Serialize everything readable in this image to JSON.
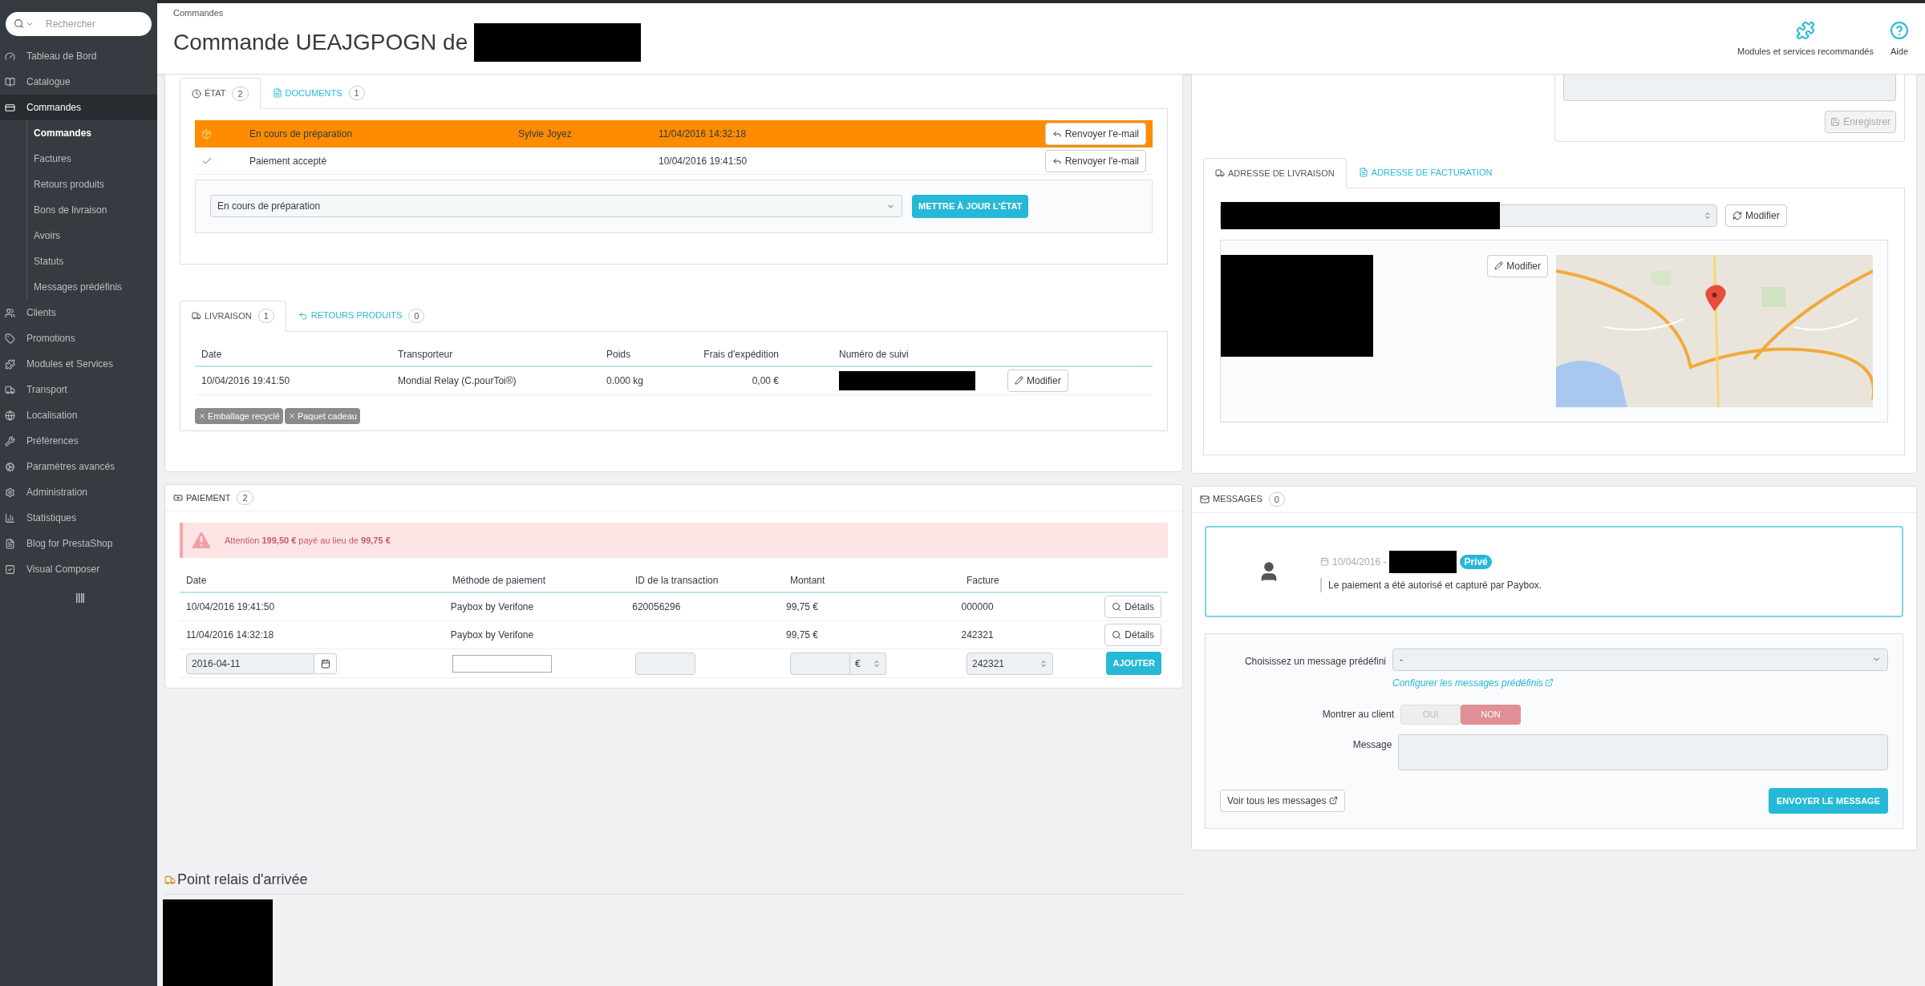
{
  "header": {
    "breadcrumb": "Commandes",
    "title": "Commande UEAJGPOGN de",
    "actions": [
      {
        "label": "Modules et services recommandés",
        "kind": "puzzle"
      },
      {
        "label": "Aide",
        "kind": "help"
      }
    ]
  },
  "sidebar": {
    "search_placeholder": "Rechercher",
    "items": [
      {
        "label": "Tableau de Bord",
        "kind": "gauge",
        "selected": false
      },
      {
        "label": "Catalogue",
        "kind": "book",
        "selected": false
      },
      {
        "label": "Commandes",
        "kind": "card",
        "selected": true,
        "children": [
          {
            "label": "Commandes",
            "selected": true
          },
          {
            "label": "Factures",
            "selected": false
          },
          {
            "label": "Retours produits",
            "selected": false
          },
          {
            "label": "Bons de livraison",
            "selected": false
          },
          {
            "label": "Avoirs",
            "selected": false
          },
          {
            "label": "Statuts",
            "selected": false
          },
          {
            "label": "Messages prédéfinis",
            "selected": false
          }
        ]
      },
      {
        "label": "Clients",
        "kind": "users",
        "selected": false
      },
      {
        "label": "Promotions",
        "kind": "tag",
        "selected": false
      },
      {
        "label": "Modules et Services",
        "kind": "puzzle",
        "selected": false
      },
      {
        "label": "Transport",
        "kind": "truck",
        "selected": false
      },
      {
        "label": "Localisation",
        "kind": "globe",
        "selected": false
      },
      {
        "label": "Préférences",
        "kind": "wrench",
        "selected": false
      },
      {
        "label": "Paramètres avancés",
        "kind": "cogs",
        "selected": false
      },
      {
        "label": "Administration",
        "kind": "cog",
        "selected": false
      },
      {
        "label": "Statistiques",
        "kind": "chart",
        "selected": false
      },
      {
        "label": "Blog for PrestaShop",
        "kind": "file",
        "selected": false
      },
      {
        "label": "Visual Composer",
        "kind": "square",
        "selected": false
      }
    ]
  },
  "status_panel": {
    "tabs": [
      {
        "label": "ÉTAT",
        "count": "2",
        "kind": "clock",
        "selected": true
      },
      {
        "label": "DOCUMENTS",
        "count": "1",
        "kind": "file",
        "selected": false
      }
    ],
    "history": [
      {
        "kind": "box",
        "status": "En cours de préparation",
        "employee": "Sylvie Joyez",
        "date": "11/04/2016 14:32:18",
        "button": "Renvoyer l'e-mail",
        "highlighted": true
      },
      {
        "kind": "check",
        "status": "Paiement accepté",
        "date": "10/04/2016 19:41:50",
        "button": "Renvoyer l'e-mail",
        "highlighted": false
      }
    ],
    "select_value": "En cours de préparation",
    "update_button": "METTRE À JOUR L'ÉTAT"
  },
  "shipping_panel": {
    "tabs": [
      {
        "label": "LIVRAISON",
        "count": "1",
        "kind": "truck",
        "selected": true
      },
      {
        "label": "RETOURS PRODUITS",
        "count": "0",
        "kind": "undo",
        "selected": false
      }
    ],
    "columns": [
      "Date",
      "Transporteur",
      "Poids",
      "Frais d'expédition",
      "Numéro de suivi"
    ],
    "rows": [
      {
        "date": "10/04/2016 19:41:50",
        "carrier": "Mondial Relay (C.pourToi®)",
        "weight": "0.000 kg",
        "cost": "0,00 €",
        "button": "Modifier"
      }
    ],
    "tags": [
      "Emballage recyclé",
      "Paquet cadeau"
    ]
  },
  "payment_panel": {
    "title": "PAIEMENT",
    "count": "2",
    "alert": "Attention **199,50 €** payé au lieu de **99,75 €**",
    "columns": [
      "Date",
      "Méthode de paiement",
      "ID de la transaction",
      "Montant",
      "Facture"
    ],
    "rows": [
      {
        "date": "10/04/2016 19:41:50",
        "method": "Paybox by Verifone",
        "transaction_id": "620056296",
        "amount": "99,75 €",
        "invoice": "000000",
        "button": "Détails"
      },
      {
        "date": "11/04/2016 14:32:18",
        "method": "Paybox by Verifone",
        "amount": "99,75 €",
        "invoice": "242321",
        "button": "Détails"
      }
    ],
    "form": {
      "date": "2016-04-11",
      "currency": "€",
      "invoice": "242321",
      "button": "AJOUTER"
    }
  },
  "note_panel": {
    "button": "Enregistrer",
    "disabled": true
  },
  "address_panel": {
    "tabs": [
      {
        "label": "ADRESSE DE LIVRAISON",
        "kind": "truck",
        "selected": true
      },
      {
        "label": "ADRESSE DE FACTURATION",
        "kind": "file",
        "selected": false
      }
    ],
    "change_button": "Modifier",
    "edit_button": "Modifier"
  },
  "messages_panel": {
    "title": "MESSAGES",
    "count": "0",
    "messages": [
      {
        "date": "10/04/2016 -",
        "badge": "Privé",
        "text": "Le paiement a été autorisé et capturé par Paybox."
      }
    ],
    "predefined_label": "Choisissez un message prédéfini",
    "predefined_value": "-",
    "configure_link": "Configurer les messages prédéfinis",
    "show_label": "Montrer au client",
    "toggle": [
      {
        "label": "OUI",
        "selected": false
      },
      {
        "label": "NON",
        "selected": true
      }
    ],
    "message_label": "Message",
    "all_button": "Voir tous les messages",
    "send_button": "ENVOYER LE MESSAGE"
  },
  "relay": {
    "title": "Point relais d'arrivée"
  }
}
